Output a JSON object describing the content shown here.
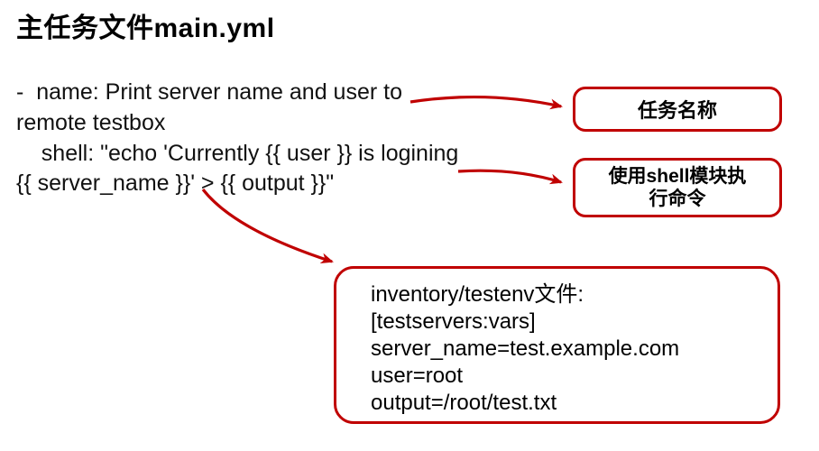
{
  "title": "主任务文件main.yml",
  "code": "-  name: Print server name and user to remote testbox\n    shell: \"echo 'Currently {{ user }} is logining {{ server_name }}' > {{ output }}\"",
  "callouts": {
    "task_name": "任务名称",
    "shell_module": "使用shell模块执\n行命令"
  },
  "info": {
    "l1": "inventory/testenv文件:",
    "l2": "[testservers:vars]",
    "l3": "server_name=test.example.com",
    "l4": "user=root",
    "l5": "output=/root/test.txt"
  }
}
